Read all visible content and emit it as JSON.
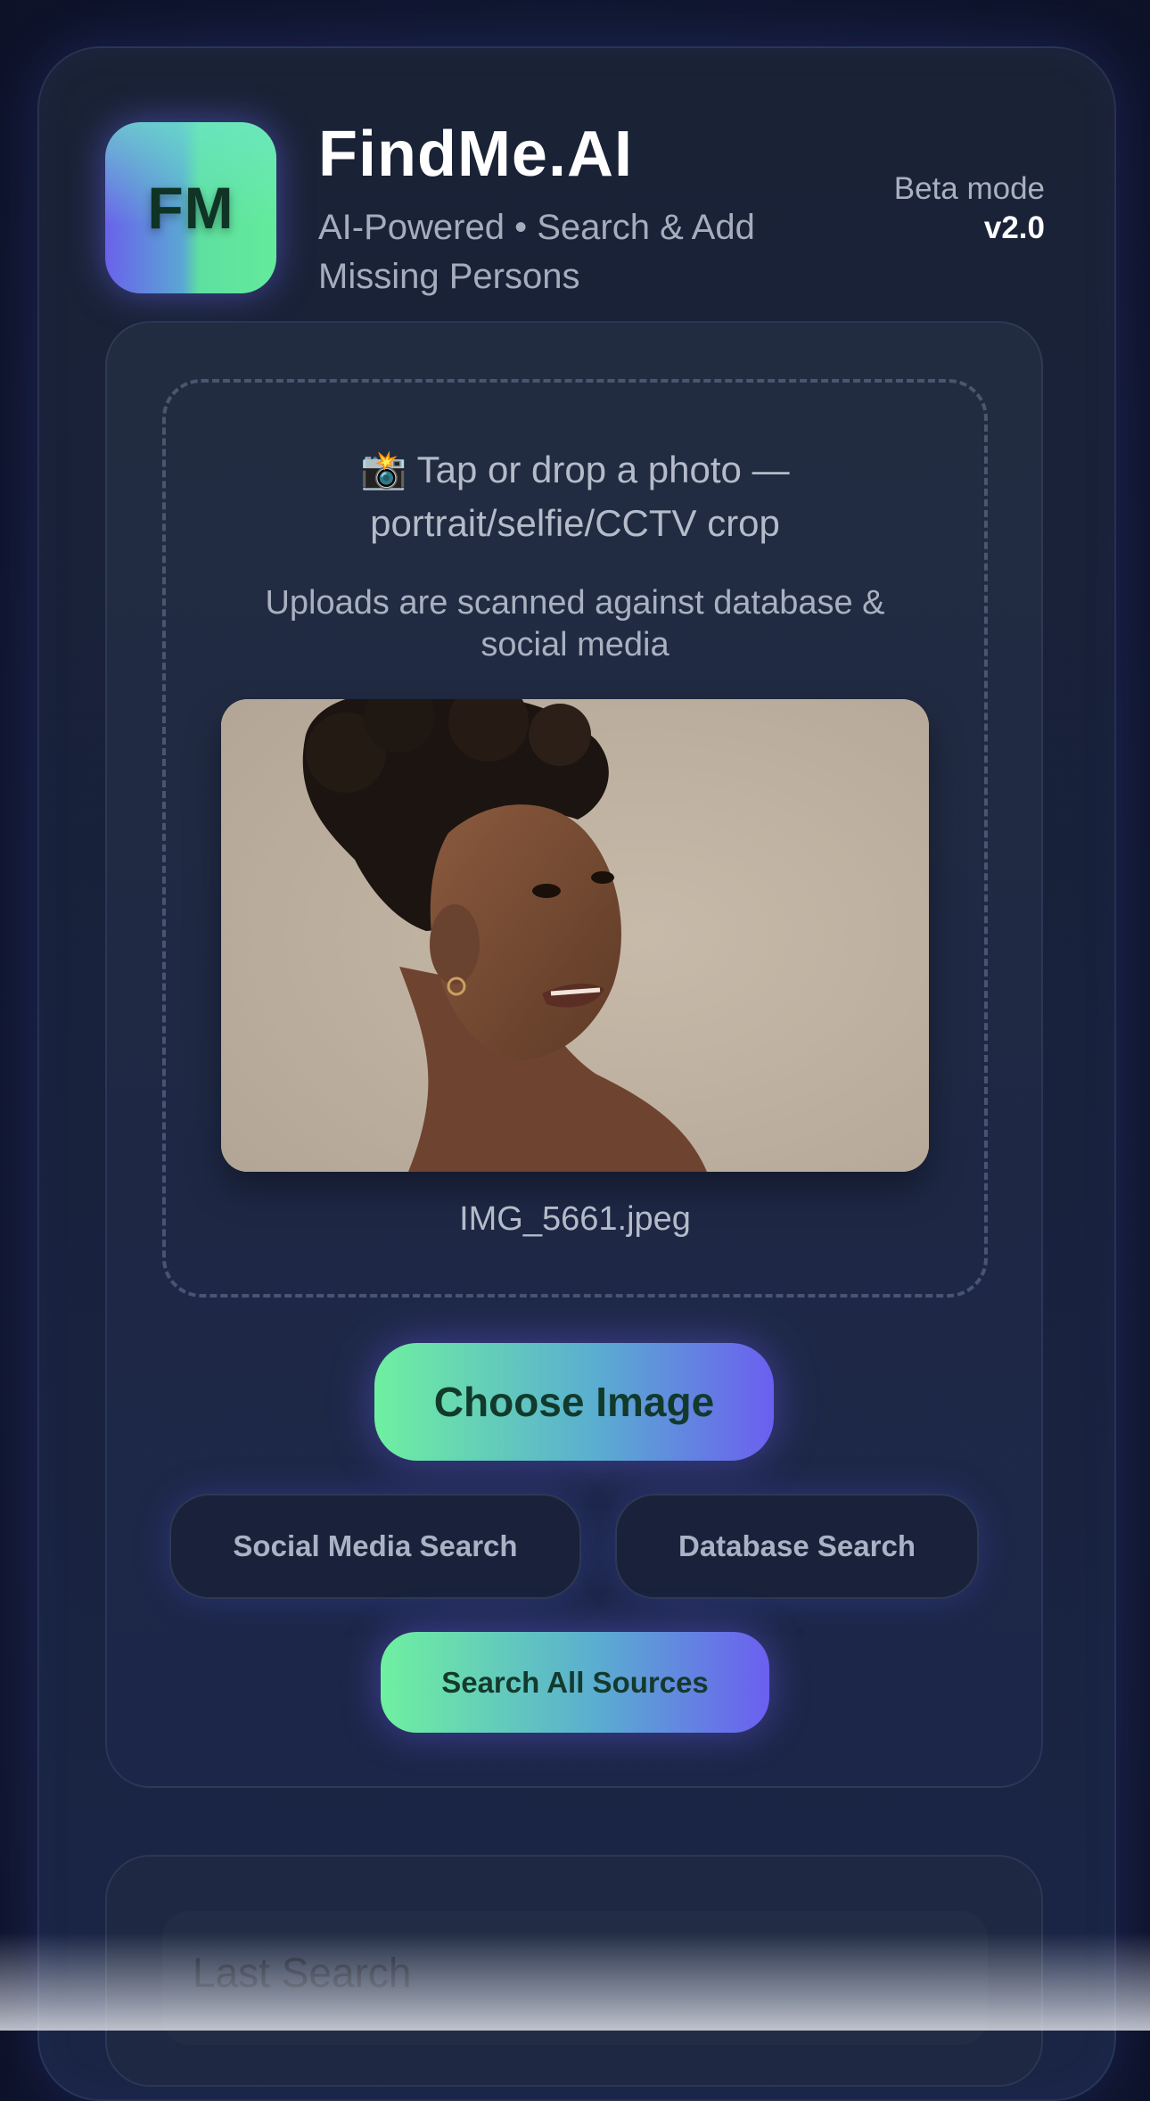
{
  "header": {
    "logo_initials": "FM",
    "app_title": "FindMe.AI",
    "subtitle": "AI-Powered • Search & Add Missing Persons",
    "beta_label": "Beta mode",
    "version": "v2.0"
  },
  "upload": {
    "camera_icon": "📸",
    "prompt_line1": "Tap or drop a photo —",
    "prompt_line2": "portrait/selfie/CCTV crop",
    "subtext": "Uploads are scanned against database & social media",
    "filename": "IMG_5661.jpeg"
  },
  "actions": {
    "choose_image": "Choose Image",
    "social_search": "Social Media Search",
    "database_search": "Database Search",
    "search_all": "Search All Sources"
  },
  "last_search": {
    "title": "Last Search",
    "toggle": "—"
  },
  "colors": {
    "accent_green": "#6ff0a0",
    "accent_purple": "#6b5ff0",
    "background": "#131b36"
  }
}
